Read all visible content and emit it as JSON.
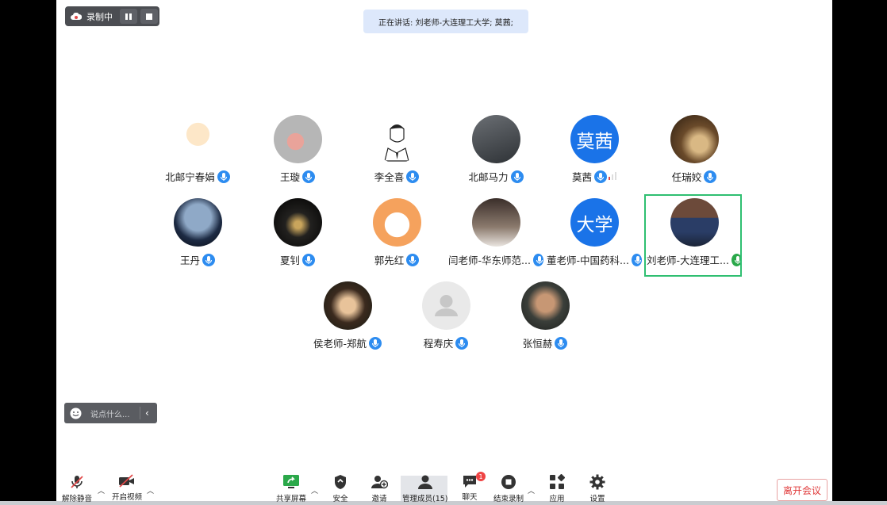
{
  "recording": {
    "label": "录制中"
  },
  "speaking": {
    "text": "正在讲话: 刘老师-大连理工大学; 莫茜;"
  },
  "participants": [
    {
      "name": "北邮宁春娟"
    },
    {
      "name": "王璇"
    },
    {
      "name": "李全喜"
    },
    {
      "name": "北邮马力"
    },
    {
      "name": "莫茜",
      "avatar_text": "莫茜"
    },
    {
      "name": "任瑞姣"
    },
    {
      "name": "王丹"
    },
    {
      "name": "夏钊"
    },
    {
      "name": "郭先红"
    },
    {
      "name": "闫老师-华东师范..."
    },
    {
      "name": "董老师-中国药科...",
      "avatar_text": "大学"
    },
    {
      "name": "刘老师-大连理工..."
    },
    {
      "name": "侯老师-郑航"
    },
    {
      "name": "程寿庆"
    },
    {
      "name": "张恒赫"
    }
  ],
  "chat": {
    "placeholder": "说点什么..."
  },
  "toolbar": {
    "mute": "解除静音",
    "video": "开启视频",
    "share": "共享屏幕",
    "security": "安全",
    "invite": "邀请",
    "members": "管理成员(15)",
    "chat": "聊天",
    "chat_badge": "1",
    "end_recording": "结束录制",
    "apps": "应用",
    "settings": "设置"
  },
  "leave_button": "离开会议",
  "colors": {
    "accent": "#2d8cf0",
    "active_speaker": "#2fbf71",
    "leave": "#e03a3a"
  }
}
